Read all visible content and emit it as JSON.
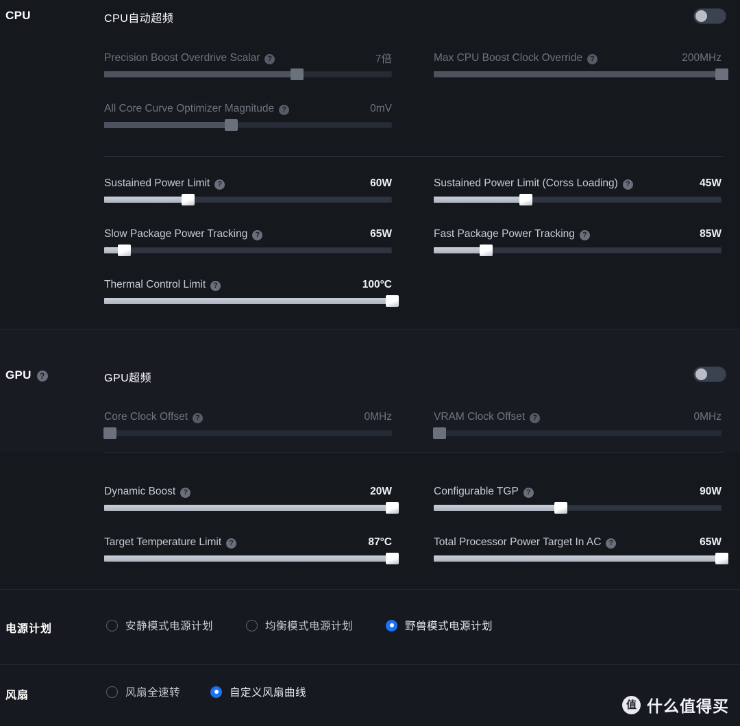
{
  "sections": {
    "cpu": {
      "gutter_label": "CPU",
      "group_title": "CPU自动超频",
      "toggle_state": "off",
      "overclock_controls": [
        {
          "label": "Precision Boost Overdrive Scalar",
          "value": "7倍",
          "percent": 67,
          "enabled": false
        },
        {
          "label": "Max CPU Boost Clock Override",
          "value": "200MHz",
          "percent": 100,
          "enabled": false
        },
        {
          "label": "All Core Curve Optimizer Magnitude",
          "value": "0mV",
          "percent": 44,
          "enabled": false
        }
      ],
      "power_controls": [
        {
          "label": "Sustained Power Limit",
          "value": "60W",
          "percent": 29,
          "enabled": true
        },
        {
          "label": "Sustained Power Limit (Corss Loading)",
          "value": "45W",
          "percent": 32,
          "enabled": true
        },
        {
          "label": "Slow Package Power Tracking",
          "value": "65W",
          "percent": 7,
          "enabled": true
        },
        {
          "label": "Fast Package Power Tracking",
          "value": "85W",
          "percent": 18,
          "enabled": true
        },
        {
          "label": "Thermal Control Limit",
          "value": "100°C",
          "percent": 100,
          "enabled": true
        }
      ]
    },
    "gpu": {
      "gutter_label": "GPU",
      "gutter_has_help": true,
      "group_title": "GPU超频",
      "toggle_state": "off",
      "clock_controls": [
        {
          "label": "Core Clock Offset",
          "value": "0MHz",
          "percent": 1,
          "enabled": false
        },
        {
          "label": "VRAM Clock Offset",
          "value": "0MHz",
          "percent": 1,
          "enabled": false
        }
      ],
      "power_controls": [
        {
          "label": "Dynamic Boost",
          "value": "20W",
          "percent": 100,
          "enabled": true
        },
        {
          "label": "Configurable TGP",
          "value": "90W",
          "percent": 44,
          "enabled": true
        },
        {
          "label": "Target Temperature Limit",
          "value": "87°C",
          "percent": 100,
          "enabled": true
        },
        {
          "label": "Total Processor Power Target In AC",
          "value": "65W",
          "percent": 100,
          "enabled": true
        }
      ]
    },
    "power_plan": {
      "gutter_label": "电源计划",
      "options": [
        {
          "label": "安静模式电源计划",
          "selected": false
        },
        {
          "label": "均衡模式电源计划",
          "selected": false
        },
        {
          "label": "野兽模式电源计划",
          "selected": true
        }
      ]
    },
    "fan": {
      "gutter_label": "风扇",
      "options": [
        {
          "label": "风扇全速转",
          "selected": false
        },
        {
          "label": "自定义风扇曲线",
          "selected": true
        }
      ]
    }
  },
  "watermark": {
    "logo_char": "值",
    "text": "什么值得买"
  },
  "icons": {
    "help": "?"
  },
  "colors": {
    "accent": "#1b72f2",
    "background": "#15181d",
    "slider_active": "#c9cfd8",
    "slider_disabled": "#4c535e"
  }
}
